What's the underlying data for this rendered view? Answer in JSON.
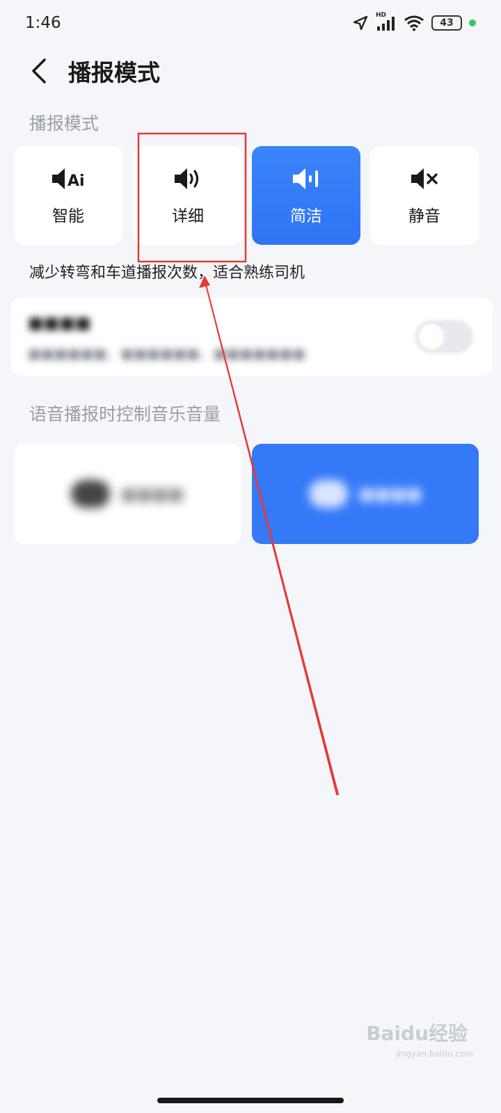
{
  "status": {
    "time": "1:46",
    "battery": "43",
    "network_label": "HD"
  },
  "header": {
    "title": "播报模式"
  },
  "broadcast": {
    "section_label": "播报模式",
    "modes": [
      {
        "label": "智能",
        "icon": "speaker-ai-icon",
        "active": false
      },
      {
        "label": "详细",
        "icon": "speaker-detailed-icon",
        "active": false
      },
      {
        "label": "简洁",
        "icon": "speaker-concise-icon",
        "active": true
      },
      {
        "label": "静音",
        "icon": "speaker-mute-icon",
        "active": false
      }
    ],
    "description": "减少转弯和车道播报次数，适合熟练司机"
  },
  "setting_row": {
    "title": "■■■■",
    "subtitle": "■■■■■■，■■■■■■，■■■■■■■",
    "toggle_on": false
  },
  "music": {
    "section_label": "语音播报时控制音乐音量",
    "options": [
      {
        "label": "■■■■",
        "active": false
      },
      {
        "label": "■■■■",
        "active": true
      }
    ]
  },
  "colors": {
    "accent": "#2f74f5",
    "annotation": "#e53935",
    "background": "#f4f6f9"
  },
  "watermark": {
    "text": "Baidu经验",
    "sub": "jingyan.baidu.com"
  }
}
